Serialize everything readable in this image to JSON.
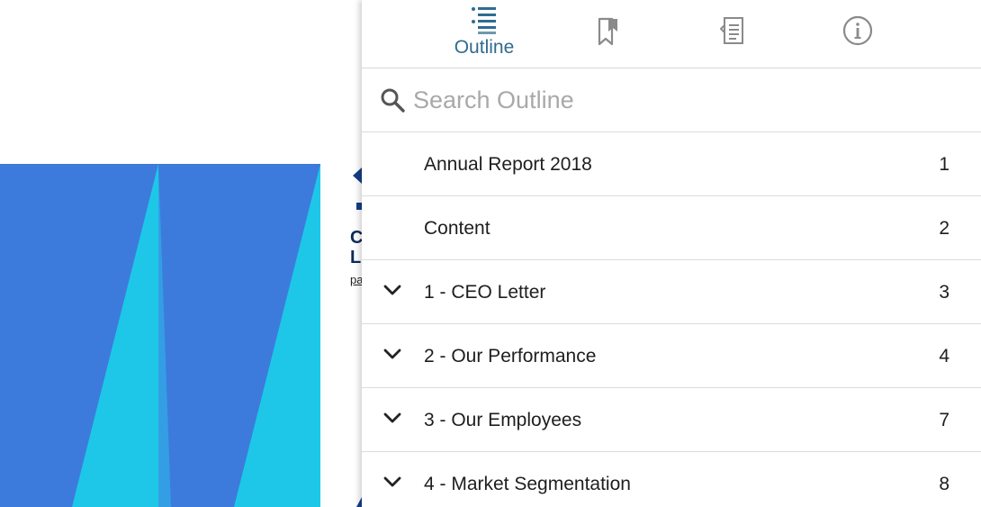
{
  "colors": {
    "accent": "#2f6c8f",
    "page_blue": "#3c7bdc",
    "page_cyan": "#1cc6e8",
    "doc_navy": "#163e86"
  },
  "document": {
    "fragment_c": "C",
    "fragment_l": "L",
    "fragment_pa": "pa"
  },
  "tabs": [
    {
      "name": "outline",
      "label": "Outline",
      "icon": "outline-list-icon",
      "active": true
    },
    {
      "name": "bookmarks",
      "icon": "bookmark-icon",
      "active": false
    },
    {
      "name": "annotations",
      "icon": "annotations-icon",
      "active": false
    },
    {
      "name": "info",
      "icon": "info-icon",
      "active": false
    }
  ],
  "search": {
    "placeholder": "Search Outline",
    "icon": "search-icon"
  },
  "outline": {
    "items": [
      {
        "title": "Annual Report 2018",
        "page": "1",
        "expandable": false
      },
      {
        "title": "Content",
        "page": "2",
        "expandable": false
      },
      {
        "title": "1 - CEO Letter",
        "page": "3",
        "expandable": true
      },
      {
        "title": "2 - Our Performance",
        "page": "4",
        "expandable": true
      },
      {
        "title": "3 - Our Employees",
        "page": "7",
        "expandable": true
      },
      {
        "title": "4 - Market Segmentation",
        "page": "8",
        "expandable": true
      }
    ]
  }
}
